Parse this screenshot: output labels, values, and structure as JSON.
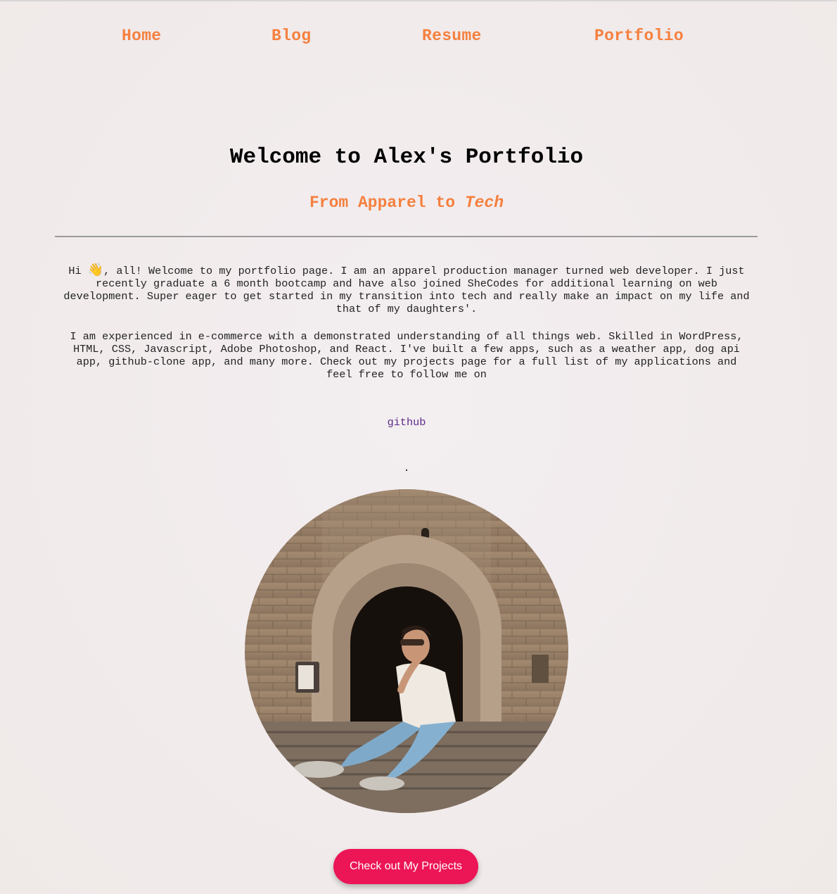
{
  "nav": {
    "items": [
      {
        "label": "Home"
      },
      {
        "label": "Blog"
      },
      {
        "label": "Resume"
      },
      {
        "label": "Portfolio"
      }
    ]
  },
  "header": {
    "title": "Welcome to Alex's Portfolio",
    "subtitle_prefix": "From Apparel to ",
    "subtitle_emphasis": "Tech"
  },
  "intro": {
    "greeting_prefix": "Hi ",
    "greeting_icon": "waving-hand-icon",
    "greeting_emoji": "👋",
    "paragraph1_rest": ", all! Welcome to my portfolio page. I am an apparel production manager turned web developer. I just recently graduate a 6 month bootcamp and have also joined SheCodes for additional learning on web development. Super eager to get started in my transition into tech and really make an impact on my life and that of my daughters'.",
    "paragraph2": "I am experienced in e-commerce with a demonstrated understanding of all things web. Skilled in WordPress, HTML, CSS, Javascript, Adobe Photoshop, and React. I've built a few apps, such as a weather app, dog api app, github-clone app, and many more. Check out my projects page for a full list of my applications and feel free to follow me on",
    "github_link": "github",
    "trailing_period": "."
  },
  "cta": {
    "label": "Check out My Projects"
  },
  "colors": {
    "accent": "#f5803e",
    "button": "#ec1556",
    "link": "#5b2a86",
    "background": "#f2ecee"
  }
}
